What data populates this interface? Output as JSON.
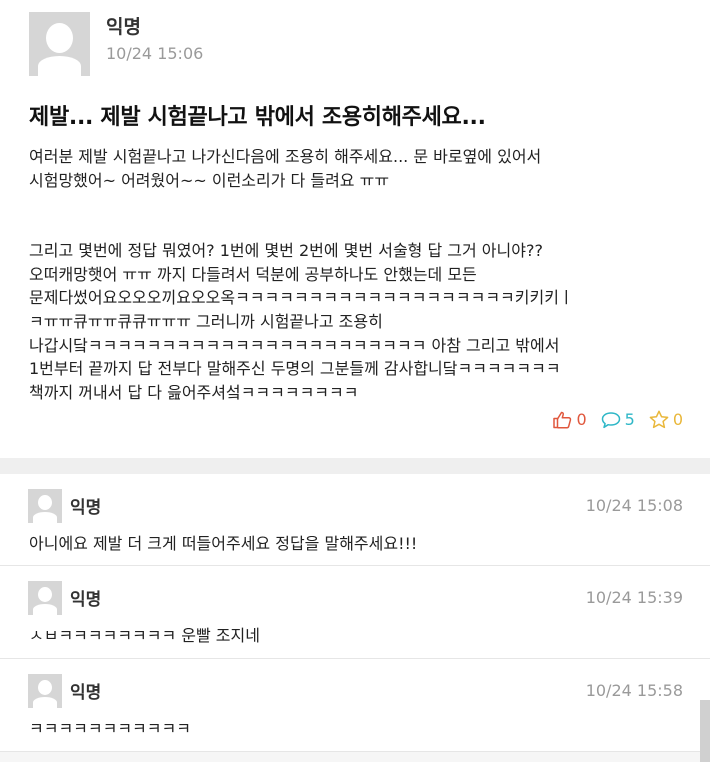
{
  "post": {
    "author": "익명",
    "time": "10/24 15:06",
    "title": "제발... 제발 시험끝나고 밖에서 조용히해주세요...",
    "paragraph1": [
      "여러분 제발 시험끝나고 나가신다음에 조용히 해주세요... 문 바로옆에 있어서",
      "시험망했어~ 어려웠어~~ 이런소리가 다 들려요 ㅠㅠ"
    ],
    "paragraph2": [
      "그리고 몇번에 정답 뭐였어? 1번에 몇번 2번에 몇번 서술형 답 그거 아니야??",
      "오떠캐망햇어 ㅠㅠ 까지 다들려서 덕분에 공부하나도 안했는데 모든",
      "문제다썼어요오오오끼요오오옥ㅋㅋㅋㅋㅋㅋㅋㅋㅋㅋㅋㅋㅋㅋㅋㅋㅋㅋㅋ키키키ㅣ",
      "ㅋㅠㅠ큐ㅠㅠ큐큐ㅠㅠㅠ 그러니까 시험끝나고 조용히",
      "나갑시닼ㅋㅋㅋㅋㅋㅋㅋㅋㅋㅋㅋㅋㅋㅋㅋㅋㅋㅋㅋㅋㅋㅋㅋ 아참 그리고 밖에서",
      "1번부터 끝까지 답 전부다 말해주신 두명의 그분들께 감사합니닼ㅋㅋㅋㅋㅋㅋㅋ",
      "책까지 꺼내서 답 다 읊어주셔섴ㅋㅋㅋㅋㅋㅋㅋㅋ"
    ],
    "likes": "0",
    "comments": "5",
    "scraps": "0"
  },
  "comments": [
    {
      "author": "익명",
      "time": "10/24 15:08",
      "text": "아니에요 제발 더 크게 떠들어주세요 정답을 말해주세요!!!"
    },
    {
      "author": "익명",
      "time": "10/24 15:39",
      "text": "ㅅㅂㅋㅋㅋㅋㅋㅋㅋㅋ 운빨 조지네"
    },
    {
      "author": "익명",
      "time": "10/24 15:58",
      "text": "ㅋㅋㅋㅋㅋㅋㅋㅋㅋㅋㅋ"
    }
  ],
  "colors": {
    "like": "#e0573d",
    "comment": "#2fb7c7",
    "scrap": "#e9b73a",
    "avatar_bg": "#d6d6d6",
    "time_text": "#9a9a9a"
  },
  "icons": {
    "avatar": "profile-placeholder-icon",
    "like": "thumbs-up-icon",
    "comment": "speech-bubble-icon",
    "scrap": "star-icon"
  }
}
